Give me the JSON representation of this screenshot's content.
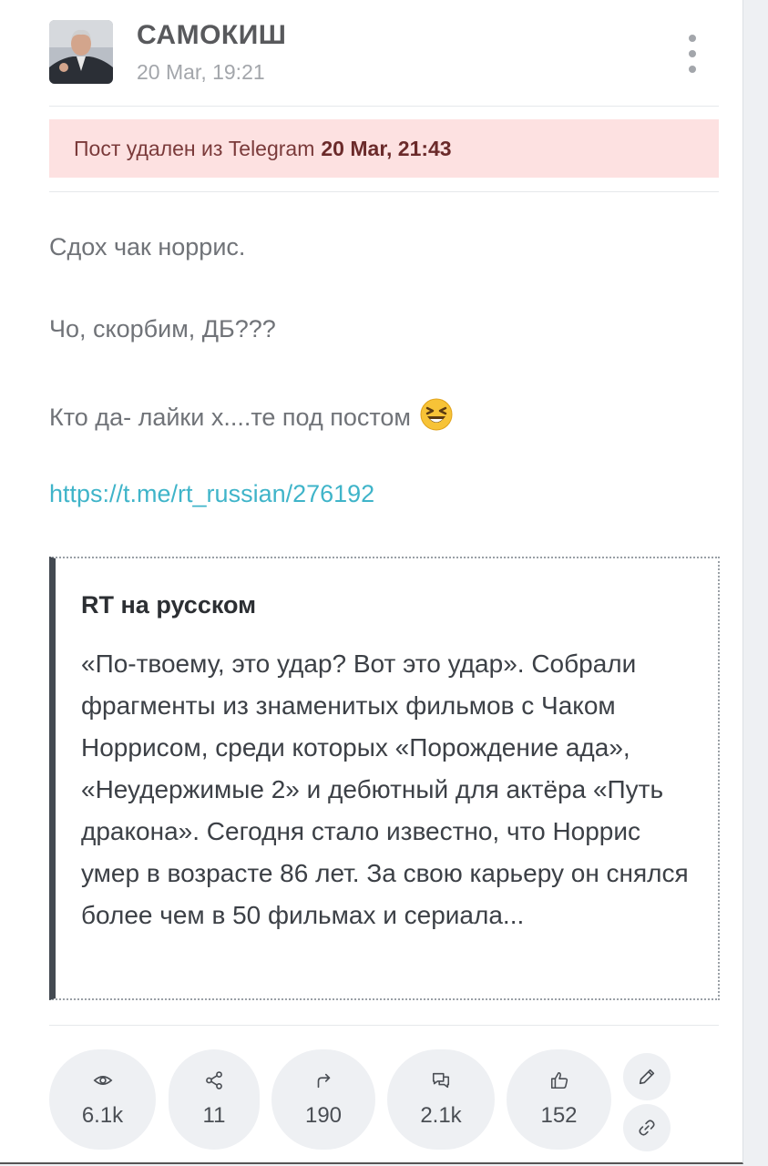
{
  "post": {
    "channel_name": "САМОКИШ",
    "date": "20 Mar, 19:21",
    "deleted_notice": {
      "text": "Пост удален из Telegram",
      "datetime": "20 Mar, 21:43"
    },
    "lines": [
      "Сдох чак норрис.",
      "Чо, скорбим, ДБ???",
      "Кто да- лайки х....те под постом"
    ],
    "emoji": "laughing-face",
    "link": "https://t.me/rt_russian/276192"
  },
  "quote": {
    "title": "RT на русском",
    "text": "«По-твоему, это удар? Вот это удар». Собрали фрагменты из знаменитых фильмов с Чаком Норрисом, среди которых «Порождение ада», «Неудержимые 2» и дебютный для актёра «Путь дракона». Сегодня стало известно, что Норрис умер в возрасте 86 лет. За свою карьеру он снялся более чем в 50 фильмах и сериала..."
  },
  "stats": {
    "views": "6.1k",
    "shares": "11",
    "forwards": "190",
    "comments": "2.1k",
    "likes": "152"
  },
  "icons": {
    "views": "eye-icon",
    "shares": "share-nodes-icon",
    "forwards": "forward-arrow-icon",
    "comments": "comments-icon",
    "likes": "thumbs-up-icon",
    "edit": "pencil-icon",
    "link": "link-icon",
    "menu": "more-vertical-icon"
  },
  "colors": {
    "deleted_bg": "#fde1e1",
    "link": "#3fb4c9",
    "quote_bar": "#444a52"
  }
}
